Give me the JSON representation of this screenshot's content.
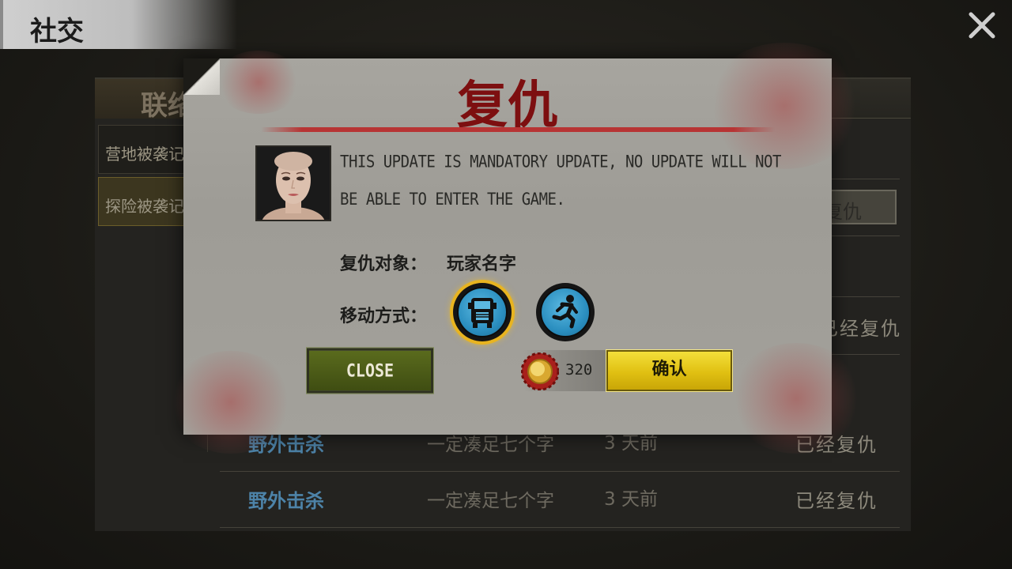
{
  "screen": {
    "title": "社交",
    "close_icon": "close-icon"
  },
  "panel": {
    "tab_label": "联络",
    "side_items": [
      {
        "label": "营地被袭记",
        "active": false
      },
      {
        "label": "探险被袭记",
        "active": true
      }
    ],
    "revenge_button_label": "复仇",
    "status_partial": "已经复仇",
    "rows": [
      {
        "type": "野外击杀",
        "name": "一定凑足七个字",
        "time": "3 天前",
        "status": "已经复仇"
      },
      {
        "type": "野外击杀",
        "name": "一定凑足七个字",
        "time": "3 天前",
        "status": "已经复仇"
      }
    ]
  },
  "dialog": {
    "title": "复仇",
    "message": "THIS UPDATE IS MANDATORY UPDATE, NO UPDATE WILL NOT BE ABLE TO ENTER THE GAME.",
    "target_label": "复仇对象：",
    "target_value": "玩家名字",
    "move_label": "移动方式：",
    "move_options": [
      {
        "icon": "truck-icon",
        "selected": true
      },
      {
        "icon": "running-man-icon",
        "selected": false
      }
    ],
    "close_label": "CLOSE",
    "cost_icon": "coin-icon",
    "cost_value": "320",
    "confirm_label": "确认"
  },
  "colors": {
    "title_red": "#7d0f10",
    "confirm_yellow": "#e0c012",
    "close_green": "#4b5c17",
    "link_blue": "#4d83a8"
  }
}
